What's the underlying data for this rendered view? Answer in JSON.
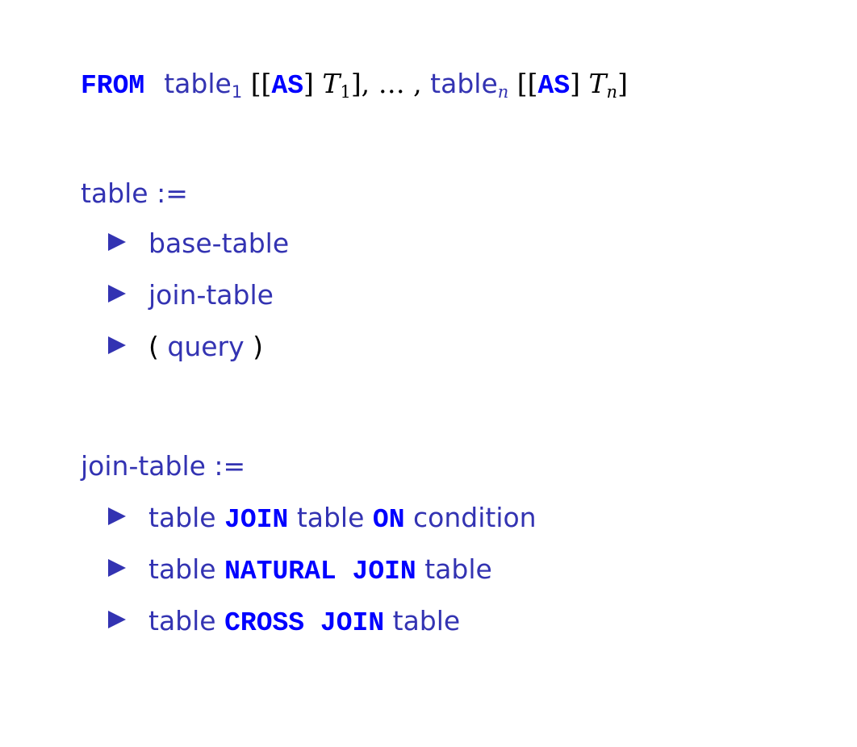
{
  "from_clause": {
    "kw_from": "FROM",
    "table1": "table",
    "sub1": "1",
    "br_open1": "[[",
    "kw_as1": "AS",
    "br_close1a": "]",
    "t1": "T",
    "t1_sub": "1",
    "br_close1b": "],",
    "dots": "… ,",
    "tablen": "table",
    "subn": "n",
    "br_open2": "[[",
    "kw_as2": "AS",
    "br_close2a": "]",
    "tn": "T",
    "tn_sub": "n",
    "br_close2b": "]"
  },
  "table_def": {
    "heading": "table :=",
    "items": [
      {
        "text": "base-table"
      },
      {
        "text": "join-table"
      },
      {
        "open": "(",
        "text": "query",
        "close": ")"
      }
    ]
  },
  "join_def": {
    "heading": "join-table :=",
    "items": [
      {
        "a": "table",
        "kw1": "JOIN",
        "b": "table",
        "kw2": "ON",
        "c": "condition"
      },
      {
        "a": "table",
        "kw1": "NATURAL JOIN",
        "b": "table"
      },
      {
        "a": "table",
        "kw1": "CROSS JOIN",
        "b": "table"
      }
    ]
  },
  "colors": {
    "text": "#3333b2",
    "keyword": "#0000ff",
    "bracket": "#000000"
  }
}
